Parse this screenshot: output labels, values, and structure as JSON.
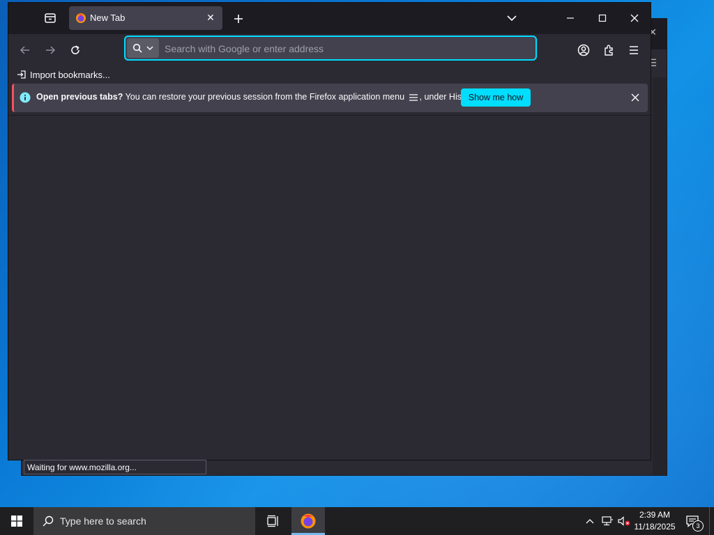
{
  "browser": {
    "tab": {
      "title": "New Tab"
    },
    "urlbar": {
      "placeholder": "Search with Google or enter address",
      "value": ""
    },
    "bookmarks_bar": {
      "import_label": "Import bookmarks..."
    },
    "notification": {
      "title": "Open previous tabs?",
      "message": "You can restore your previous session from the Firefox application menu",
      "message_suffix": ", under History.",
      "button_label": "Show me how"
    },
    "status_text": "Waiting for www.mozilla.org..."
  },
  "taskbar": {
    "search_placeholder": "Type here to search",
    "clock": {
      "time": "2:39 AM",
      "date": "11/18/2025"
    },
    "notification_count": "3"
  },
  "colors": {
    "accent": "#00ddff",
    "chrome_dark": "#1c1b22",
    "chrome": "#2b2a33",
    "tab_active": "#42414d"
  }
}
